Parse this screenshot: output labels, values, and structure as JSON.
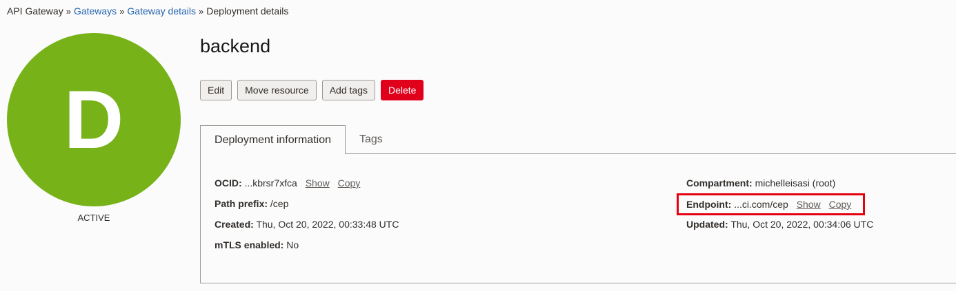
{
  "breadcrumb": {
    "items": [
      {
        "label": "API Gateway",
        "link": false
      },
      {
        "label": "Gateways",
        "link": true
      },
      {
        "label": "Gateway details",
        "link": true
      },
      {
        "label": "Deployment details",
        "link": false
      }
    ],
    "separator": "»"
  },
  "resource": {
    "initial": "D",
    "status": "ACTIVE",
    "name": "backend",
    "avatar_color": "#77b219"
  },
  "actions": {
    "edit": "Edit",
    "move": "Move resource",
    "add_tags": "Add tags",
    "delete": "Delete",
    "delete_color": "#e0001c"
  },
  "tabs": [
    {
      "label": "Deployment information"
    },
    {
      "label": "Tags"
    }
  ],
  "info": {
    "left": {
      "ocid": {
        "label": "OCID:",
        "value": "...kbrsr7xfca",
        "show": "Show",
        "copy": "Copy"
      },
      "path_prefix": {
        "label": "Path prefix:",
        "value": "/cep"
      },
      "created": {
        "label": "Created:",
        "value": "Thu, Oct 20, 2022, 00:33:48 UTC"
      },
      "mtls": {
        "label": "mTLS enabled:",
        "value": "No"
      }
    },
    "right": {
      "compartment": {
        "label": "Compartment:",
        "value": "michelleisasi (root)"
      },
      "endpoint": {
        "label": "Endpoint:",
        "value": "...ci.com/cep",
        "show": "Show",
        "copy": "Copy"
      },
      "updated": {
        "label": "Updated:",
        "value": "Thu, Oct 20, 2022, 00:34:06 UTC"
      }
    }
  },
  "highlight_color": "#e3000f"
}
